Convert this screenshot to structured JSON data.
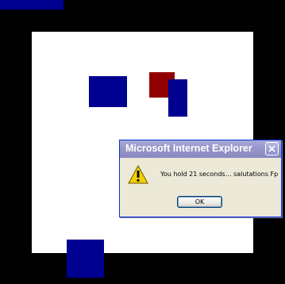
{
  "colors": {
    "background": "#000000",
    "play_area": "#ffffff",
    "enemy_blocks": "#000091",
    "player_block": "#910000",
    "dialog_titlebar": "#9696c8"
  },
  "dialog": {
    "title": "Microsoft Internet Explorer",
    "message": "You hold 21 seconds… salutations Fp",
    "ok_label": "OK",
    "icon": "warning-icon",
    "close_icon": "close-icon"
  }
}
